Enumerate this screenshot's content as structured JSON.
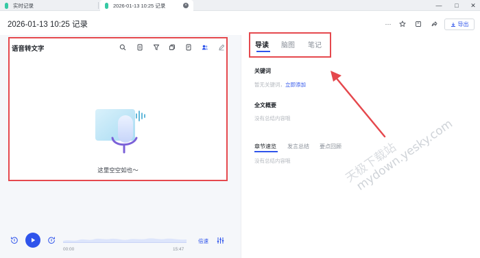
{
  "tabs": [
    {
      "label": "实时记录",
      "active": false
    },
    {
      "label": "2026-01-13 10:25 记录",
      "active": true
    }
  ],
  "window_controls": {
    "minimize": "—",
    "maximize": "□",
    "close": "✕"
  },
  "header": {
    "title": "2026-01-13 10:25 记录",
    "more_label": "···",
    "export_label": "导出"
  },
  "left": {
    "panel_title": "语音转文字",
    "tools": [
      "search-icon",
      "document-icon",
      "filter-icon",
      "copy-icon",
      "notes-icon",
      "speakers-icon",
      "pen-icon"
    ],
    "empty_text": "这里空空如也～"
  },
  "player": {
    "current_time": "00:00",
    "total_time": "15:47",
    "speed_label": "倍速"
  },
  "right": {
    "tabs": [
      "导读",
      "脑图",
      "笔记"
    ],
    "keywords": {
      "title": "关键词",
      "empty": "暂无关键词，",
      "add_link": "立即添加"
    },
    "summary": {
      "title": "全文概要",
      "empty": "没有总结内容哦"
    },
    "subtabs": [
      "章节速览",
      "发言总结",
      "要点回顾"
    ],
    "chapter_empty": "没有总结内容哦"
  },
  "watermark": {
    "line1": "天极下载站",
    "line2": "mydown.yesky.com"
  },
  "colors": {
    "accent": "#2f54eb",
    "highlight": "#e5484d"
  }
}
